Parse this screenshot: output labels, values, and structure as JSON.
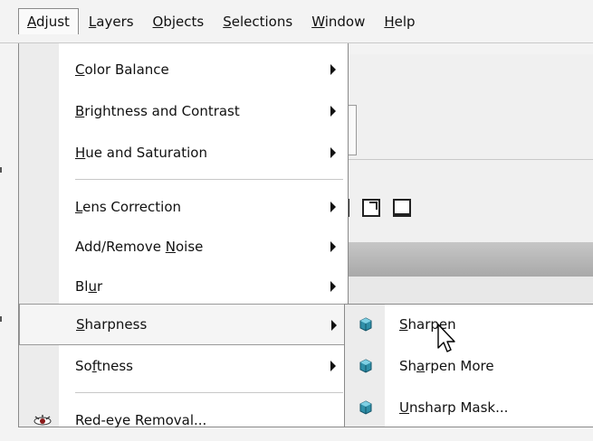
{
  "menubar": {
    "items": [
      {
        "pre": "",
        "key": "A",
        "post": "djust"
      },
      {
        "pre": "",
        "key": "L",
        "post": "ayers"
      },
      {
        "pre": "",
        "key": "O",
        "post": "bjects"
      },
      {
        "pre": "",
        "key": "S",
        "post": "elections"
      },
      {
        "pre": "",
        "key": "W",
        "post": "indow"
      },
      {
        "pre": "",
        "key": "H",
        "post": "elp"
      }
    ]
  },
  "adjust_menu": {
    "items": [
      {
        "pre": "",
        "key": "C",
        "post": "olor Balance"
      },
      {
        "pre": "",
        "key": "B",
        "post": "rightness and Contrast"
      },
      {
        "pre": "",
        "key": "H",
        "post": "ue and Saturation"
      },
      {
        "pre": "",
        "key": "L",
        "post": "ens Correction"
      },
      {
        "pre": "Add/Remove ",
        "key": "N",
        "post": "oise"
      },
      {
        "pre": "Bl",
        "key": "u",
        "post": "r"
      },
      {
        "pre": "",
        "key": "S",
        "post": "harpness"
      },
      {
        "pre": "So",
        "key": "f",
        "post": "tness"
      },
      {
        "pre": "",
        "key": "",
        "post": "Red-eye Removal..."
      }
    ]
  },
  "sharpness_submenu": {
    "items": [
      {
        "pre": "",
        "key": "S",
        "post": "harpen"
      },
      {
        "pre": "Sh",
        "key": "a",
        "post": "rpen More"
      },
      {
        "pre": "",
        "key": "U",
        "post": "nsharp Mask..."
      }
    ]
  },
  "colors": {
    "gem_icon": "#2f8fa8",
    "eye_icon": "#8b1a1a"
  }
}
